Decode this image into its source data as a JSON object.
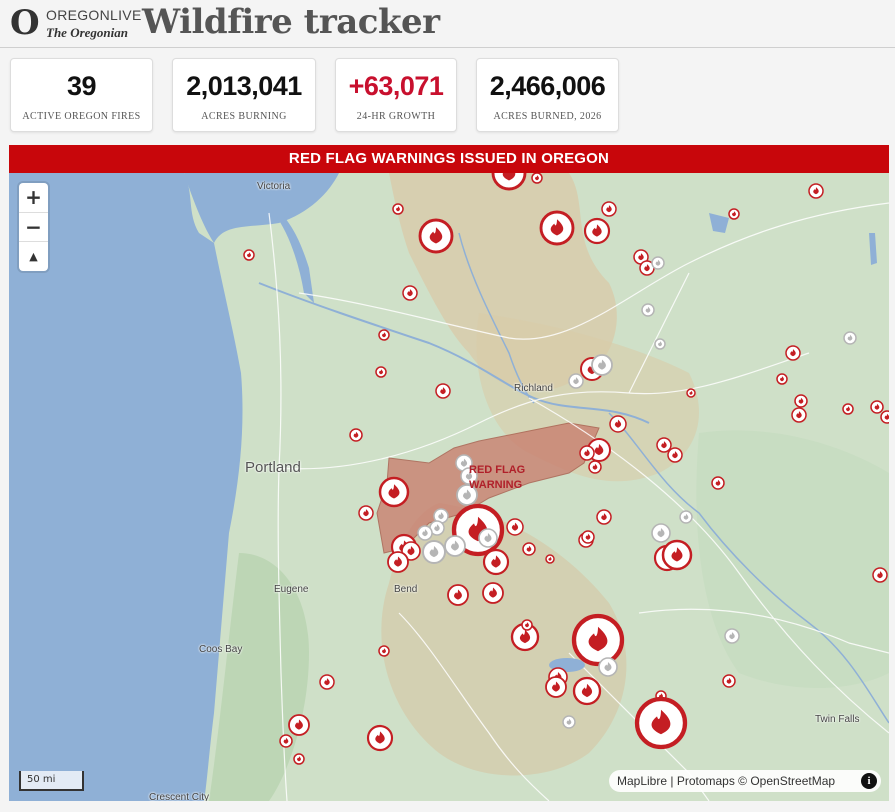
{
  "header": {
    "logo_top": "OREGONLIVE",
    "logo_bottom": "The Oregonian",
    "title": "Wildfire tracker"
  },
  "stats": [
    {
      "value": "39",
      "label": "ACTIVE OREGON FIRES",
      "highlight": false
    },
    {
      "value": "2,013,041",
      "label": "ACRES BURNING",
      "highlight": false
    },
    {
      "value": "+63,071",
      "label": "24-HR GROWTH",
      "highlight": true
    },
    {
      "value": "2,466,006",
      "label": "ACRES BURNED, 2026",
      "highlight": false
    }
  ],
  "banner": "RED FLAG WARNINGS ISSUED IN OREGON",
  "map": {
    "zoom_in": "+",
    "zoom_out": "−",
    "compass": "▲",
    "scale": "50 mi",
    "attribution": "MapLibre | Protomaps © OpenStreetMap",
    "info": "i",
    "red_flag_label": "RED FLAG WARNING",
    "places": [
      {
        "name": "Victoria",
        "size": "small"
      },
      {
        "name": "Portland",
        "size": "big"
      },
      {
        "name": "Richland",
        "size": "small"
      },
      {
        "name": "Eugene",
        "size": "small"
      },
      {
        "name": "Bend",
        "size": "small"
      },
      {
        "name": "Coos Bay",
        "size": "small"
      },
      {
        "name": "Twin Falls",
        "size": "small"
      },
      {
        "name": "Crescent City",
        "size": "small"
      }
    ]
  },
  "colors": {
    "accent": "#c8102e",
    "banner": "#c8060b",
    "fire_red": "#c41e23",
    "fire_gray": "#b5b5b5",
    "water": "#8fb0d6",
    "land": "#cfe0c8"
  }
}
